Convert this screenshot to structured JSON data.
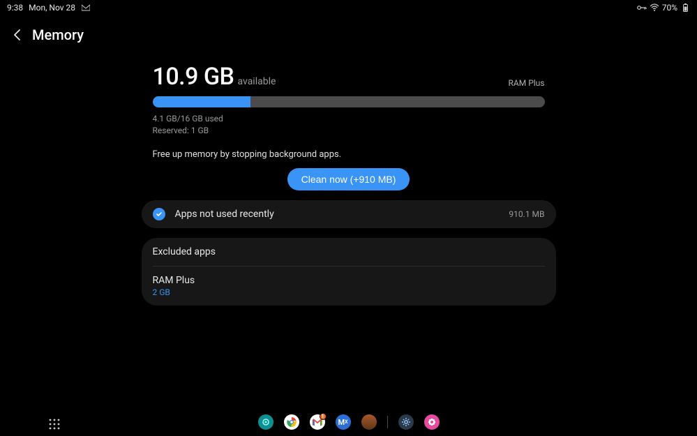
{
  "status": {
    "time": "9:38",
    "date": "Mon, Nov 28",
    "battery": "70%"
  },
  "page": {
    "title": "Memory"
  },
  "memory": {
    "available_value": "10.9 GB",
    "available_label": "available",
    "ram_plus_link": "RAM Plus",
    "used_line": "4.1 GB/16 GB used",
    "reserved_line": "Reserved: 1 GB",
    "hint": "Free up memory by stopping background apps.",
    "clean_button": "Clean now (+910 MB)",
    "progress_percent": 25
  },
  "apps_not_used": {
    "label": "Apps not used recently",
    "size": "910.1 MB"
  },
  "options": {
    "excluded_apps": "Excluded apps",
    "ram_plus_label": "RAM Plus",
    "ram_plus_value": "2 GB"
  },
  "taskbar": {
    "icons": [
      "device-care",
      "chrome",
      "gmail",
      "merx",
      "mars",
      "settings",
      "flower"
    ]
  },
  "colors": {
    "accent": "#3a94f6",
    "card": "#171717",
    "muted": "#9b9b9b"
  }
}
